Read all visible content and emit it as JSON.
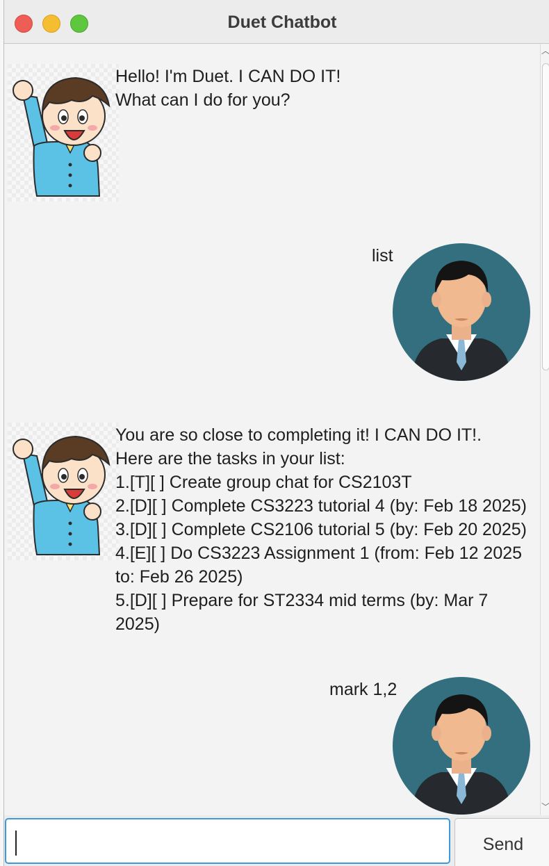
{
  "window": {
    "title": "Duet Chatbot"
  },
  "messages": [
    {
      "sender": "duet",
      "lines": [
        "Hello! I'm Duet. I CAN DO IT!",
        "What can I do for you?"
      ]
    },
    {
      "sender": "user",
      "lines": [
        "list"
      ]
    },
    {
      "sender": "duet",
      "lines": [
        "You are so close to completing it! I CAN DO IT!.",
        "Here are the tasks in your list:",
        "1.[T][ ] Create group chat for CS2103T",
        "2.[D][ ] Complete CS3223 tutorial 4 (by: Feb 18 2025)",
        "3.[D][ ] Complete CS2106 tutorial 5 (by: Feb 20 2025)",
        "4.[E][ ] Do CS3223 Assignment 1 (from: Feb 12 2025",
        "to: Feb 26 2025)",
        "5.[D][ ] Prepare for ST2334 mid terms (by: Mar 7",
        "2025)"
      ]
    },
    {
      "sender": "user",
      "lines": [
        "mark 1,2"
      ]
    }
  ],
  "input": {
    "value": "",
    "placeholder": ""
  },
  "send_button": {
    "label": "Send"
  },
  "colors": {
    "user_avatar_bg": "#346f80",
    "duet_shirt": "#5bc2e6",
    "input_focus": "#3d9ad8"
  }
}
